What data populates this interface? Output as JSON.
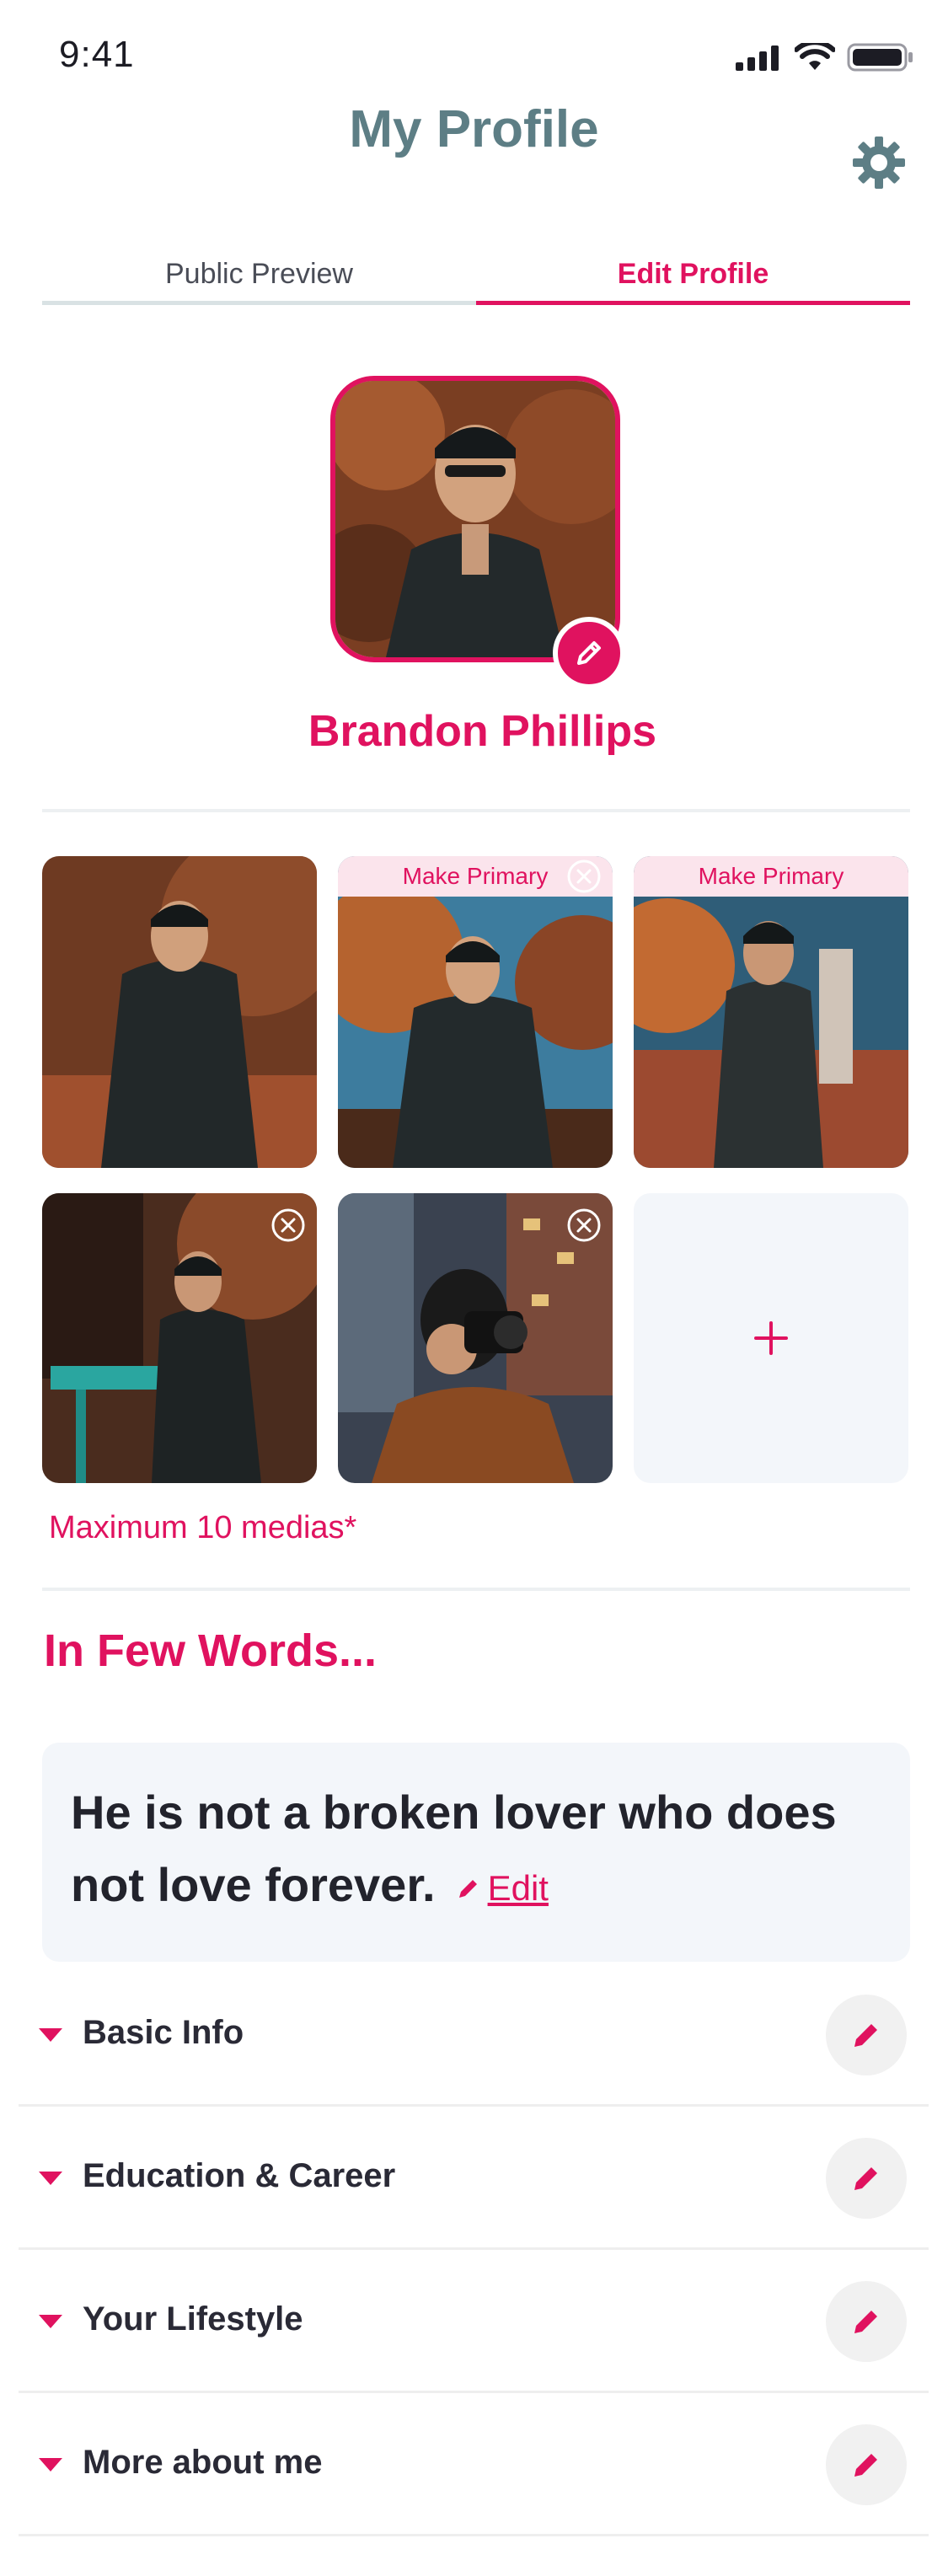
{
  "status_bar": {
    "time": "9:41"
  },
  "header": {
    "title": "My Profile"
  },
  "tabs": [
    {
      "label": "Public Preview",
      "active": false
    },
    {
      "label": "Edit Profile",
      "active": true
    }
  ],
  "profile": {
    "name": "Brandon Phillips"
  },
  "media": {
    "items": [
      {
        "primary": true
      },
      {
        "action_label": "Make Primary"
      },
      {
        "action_label": "Make Primary"
      },
      {},
      {}
    ],
    "add_symbol": "+",
    "max_note": "Maximum 10 medias*"
  },
  "bio": {
    "section_title": "In Few Words...",
    "text": "He is not a broken lover who does not love forever.",
    "edit_label": "Edit"
  },
  "sections": [
    {
      "label": "Basic Info"
    },
    {
      "label": "Education & Career"
    },
    {
      "label": "Your Lifestyle"
    },
    {
      "label": "More about me"
    }
  ],
  "colors": {
    "accent": "#e0125f",
    "title": "#5d7e85",
    "card_bg": "#f3f6fa"
  }
}
